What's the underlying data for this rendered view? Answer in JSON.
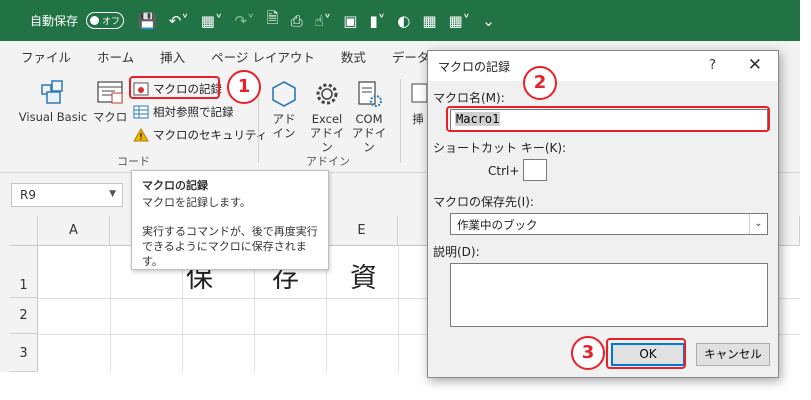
{
  "titlebar": {
    "autosave_label": "自動保存",
    "autosave_state": "オフ",
    "bg_color": "#217346"
  },
  "tabs": [
    "ファイル",
    "ホーム",
    "挿入",
    "ページ レイアウト",
    "数式",
    "データ"
  ],
  "ribbon": {
    "visual_basic": "Visual Basic",
    "macro": "マクロ",
    "record_macro": "マクロの記録",
    "relative_ref": "相対参照で記録",
    "macro_security": "マクロのセキュリティ",
    "group_code": "コード",
    "addin": [
      "アド",
      "イン"
    ],
    "excel_addin": [
      "Excel",
      "アドイン"
    ],
    "com_addin": [
      "COM",
      "アドイン"
    ],
    "group_addin": "アドイン",
    "partial_insert": "挿"
  },
  "namebox": {
    "value": "R9"
  },
  "grid": {
    "columns": [
      "A",
      "B",
      "C",
      "D",
      "E"
    ],
    "rows": [
      "1",
      "2",
      "3"
    ],
    "row1_chars": [
      "保",
      "存",
      "資"
    ]
  },
  "tooltip": {
    "title": "マクロの記録",
    "line1": "マクロを記録します。",
    "line2": "実行するコマンドが、後で再度実行",
    "line3": "できるようにマクロに保存されます。"
  },
  "dialog": {
    "title": "マクロの記録",
    "help": "?",
    "close": "✕",
    "macro_name_label": "マクロ名(M):",
    "macro_name_value": "Macro1",
    "shortcut_label": "ショートカット キー(K):",
    "ctrl_label": "Ctrl+",
    "store_label": "マクロの保存先(I):",
    "store_value": "作業中のブック",
    "desc_label": "説明(D):",
    "ok": "OK",
    "cancel": "キャンセル"
  },
  "annotations": {
    "badge1": "1",
    "badge2": "2",
    "badge3": "3",
    "color": "#e8202a"
  }
}
